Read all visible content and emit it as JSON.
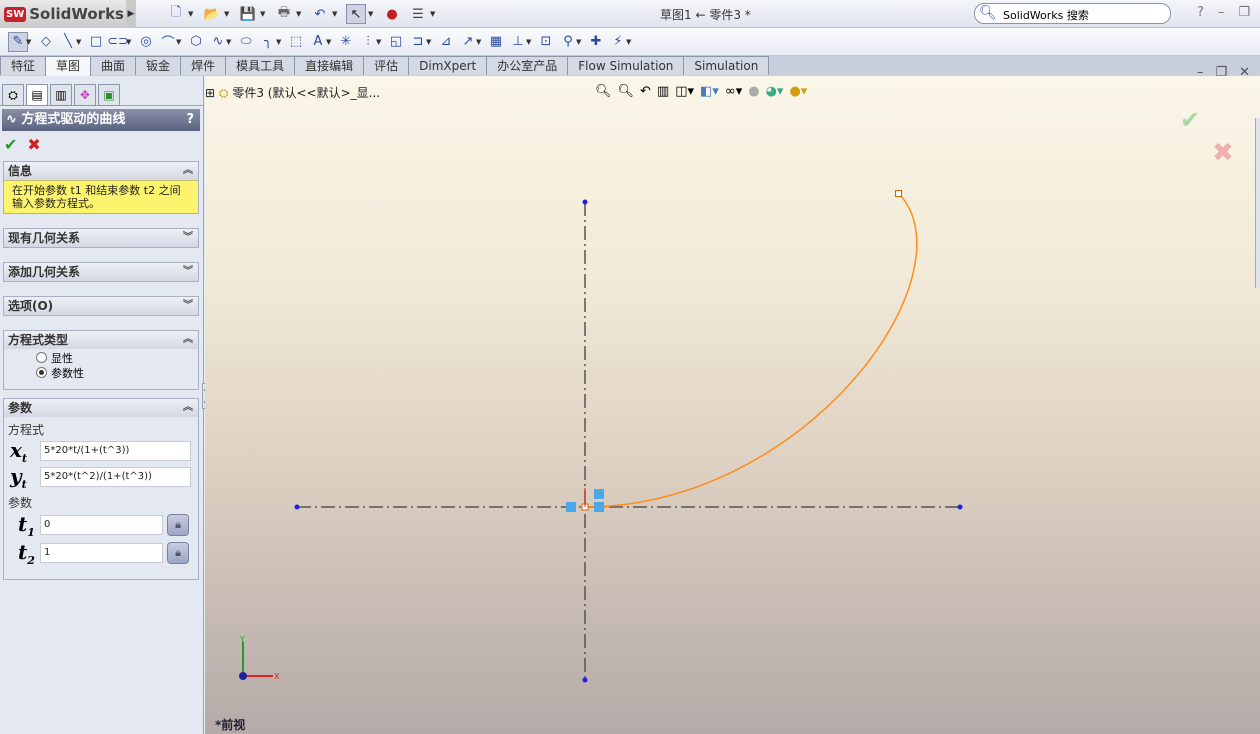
{
  "app": {
    "name": "SolidWorks",
    "logo_mark": "SW",
    "doc_title": "草图1 ← 零件3 *",
    "search_placeholder": "SolidWorks 搜索"
  },
  "quick_access": [
    "new-icon",
    "open-icon",
    "save-icon",
    "print-icon",
    "undo-icon",
    "select-icon",
    "rebuild-icon",
    "options-icon"
  ],
  "sketch_tools": [
    "sketch-icon",
    "smart-dimension-icon",
    "line-icon",
    "rectangle-icon",
    "slot-icon",
    "circle-icon",
    "arc-icon",
    "polygon-icon",
    "spline-icon",
    "ellipse-icon",
    "fillet-icon",
    "plane-icon",
    "text-icon",
    "point-icon",
    "trim-icon",
    "convert-icon",
    "offset-icon",
    "mirror-icon",
    "move-icon",
    "pattern-icon",
    "relations-icon",
    "display-relations-icon",
    "quick-snap-icon",
    "rapid-sketch-icon",
    "instant3d-icon"
  ],
  "tabs": [
    "特征",
    "草图",
    "曲面",
    "钣金",
    "焊件",
    "模具工具",
    "直接编辑",
    "评估",
    "DimXpert",
    "办公室产品",
    "Flow Simulation",
    "Simulation"
  ],
  "active_tab": "草图",
  "panel": {
    "title": "方程式驱动的曲线",
    "help": "?",
    "info": {
      "header": "信息",
      "text": "在开始参数 t1 和结束参数 t2 之间输入参数方程式。"
    },
    "sections": [
      "现有几何关系",
      "添加几何关系",
      "选项(O)"
    ],
    "type": {
      "header": "方程式类型",
      "options": [
        {
          "label": "显性",
          "selected": false
        },
        {
          "label": "参数性",
          "selected": true
        }
      ]
    },
    "params": {
      "header": "参数",
      "eq_label": "方程式",
      "xt": "5*20*t/(1+(t^3))",
      "yt": "5*20*(t^2)/(1+(t^3))",
      "param_label": "参数",
      "t1": "0",
      "t2": "1",
      "var_x": "x",
      "var_y": "y",
      "var_t": "t",
      "sub_t": "t",
      "sub_1": "1",
      "sub_2": "2"
    }
  },
  "viewport": {
    "tree_label": "零件3  (默认<<默认>_显...",
    "view_name": "*前视",
    "curve_color": "#ff8c1a",
    "axis_x": "X",
    "axis_y": "Y"
  }
}
